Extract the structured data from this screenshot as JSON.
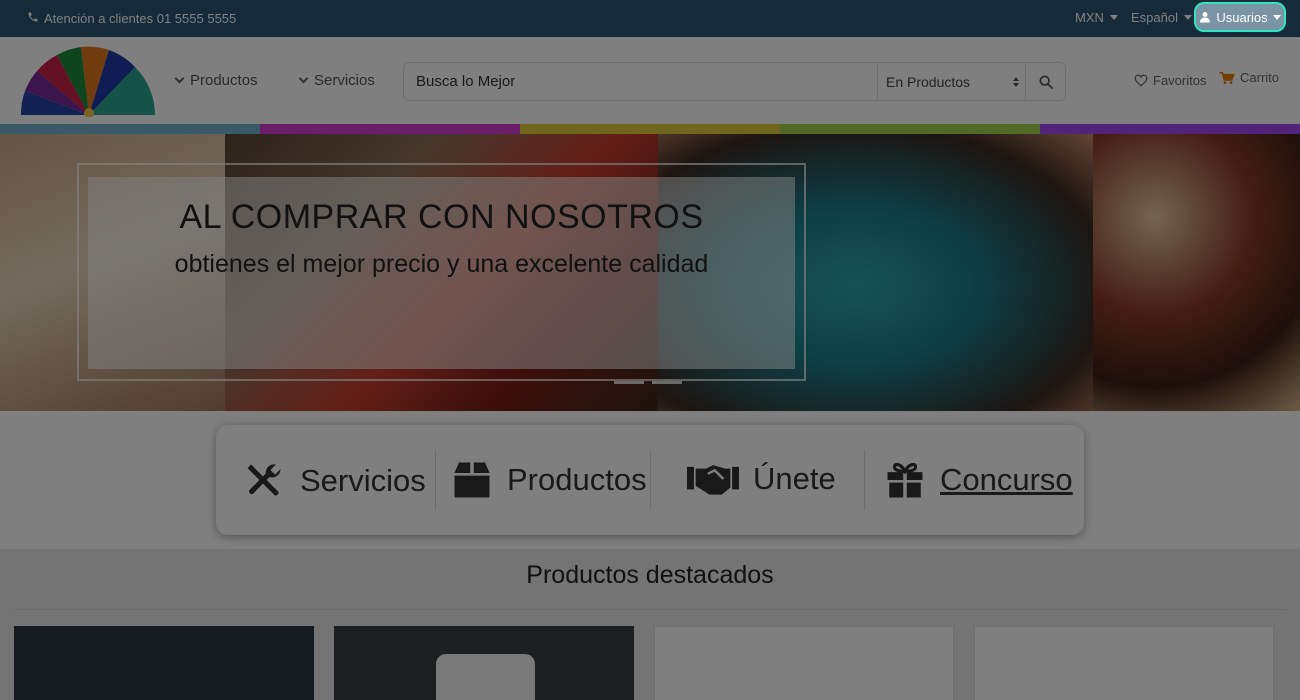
{
  "topbar": {
    "support_text": "Atención a clientes 01 5555 5555",
    "currency": "MXN",
    "language": "Español",
    "users": "Usuarios"
  },
  "header": {
    "nav": [
      {
        "label": "Productos"
      },
      {
        "label": "Servicios"
      }
    ],
    "search": {
      "placeholder": "Busca lo Mejor",
      "scope": "En Productos"
    },
    "favorites": "Favoritos",
    "cart": "Carrito"
  },
  "stripe_colors": [
    "#6fb4c9",
    "#d43bd0",
    "#e2cc3b",
    "#a6d24d",
    "#a347f5"
  ],
  "hero": {
    "title": "AL COMPRAR CON NOSOTROS",
    "subtitle": "obtienes el mejor precio y una excelente calidad"
  },
  "categories": [
    {
      "label": "Servicios",
      "icon": "tools-icon"
    },
    {
      "label": "Productos",
      "icon": "box-icon"
    },
    {
      "label": "Únete",
      "icon": "handshake-icon"
    },
    {
      "label": "Concurso",
      "icon": "gift-icon"
    }
  ],
  "featured": {
    "title": "Productos destacados"
  },
  "colors": {
    "topbar": "#2a5674",
    "highlight": "#2ee6c0",
    "cart": "#e07b00"
  }
}
